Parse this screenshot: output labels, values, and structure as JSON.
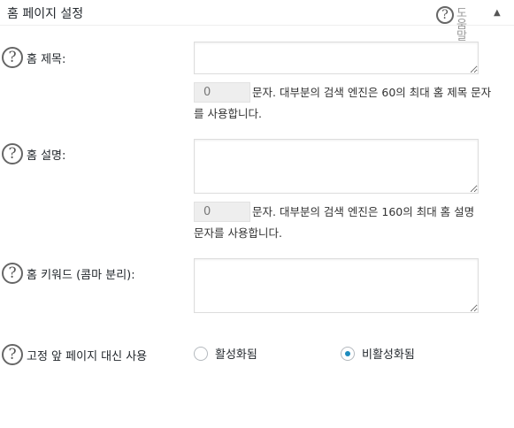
{
  "panel": {
    "title": "홈 페이지 설정",
    "help_label": "도움말",
    "help_icon": "question-circle-icon",
    "toggle_icon": "triangle-up-icon",
    "toggle_glyph": "▲"
  },
  "fields": {
    "home_title": {
      "label": "홈 제목:",
      "value": "",
      "counter": "0",
      "hint": "문자. 대부분의 검색 엔진은 60의 최대 홈 제목 문자를 사용합니다."
    },
    "home_description": {
      "label": "홈 설명:",
      "value": "",
      "counter": "0",
      "hint": "문자. 대부분의 검색 엔진은 160의 최대 홈 설명 문자를 사용합니다."
    },
    "home_keywords": {
      "label": "홈 키워드 (콤마 분리):",
      "value": ""
    },
    "static_front_page": {
      "label": "고정 앞 페이지 대신 사용",
      "options": [
        {
          "label": "활성화됨",
          "checked": false
        },
        {
          "label": "비활성화됨",
          "checked": true
        }
      ]
    }
  },
  "colors": {
    "accent": "#1e8cbe",
    "text": "#23282d",
    "counter_bg": "#eeeeee"
  }
}
